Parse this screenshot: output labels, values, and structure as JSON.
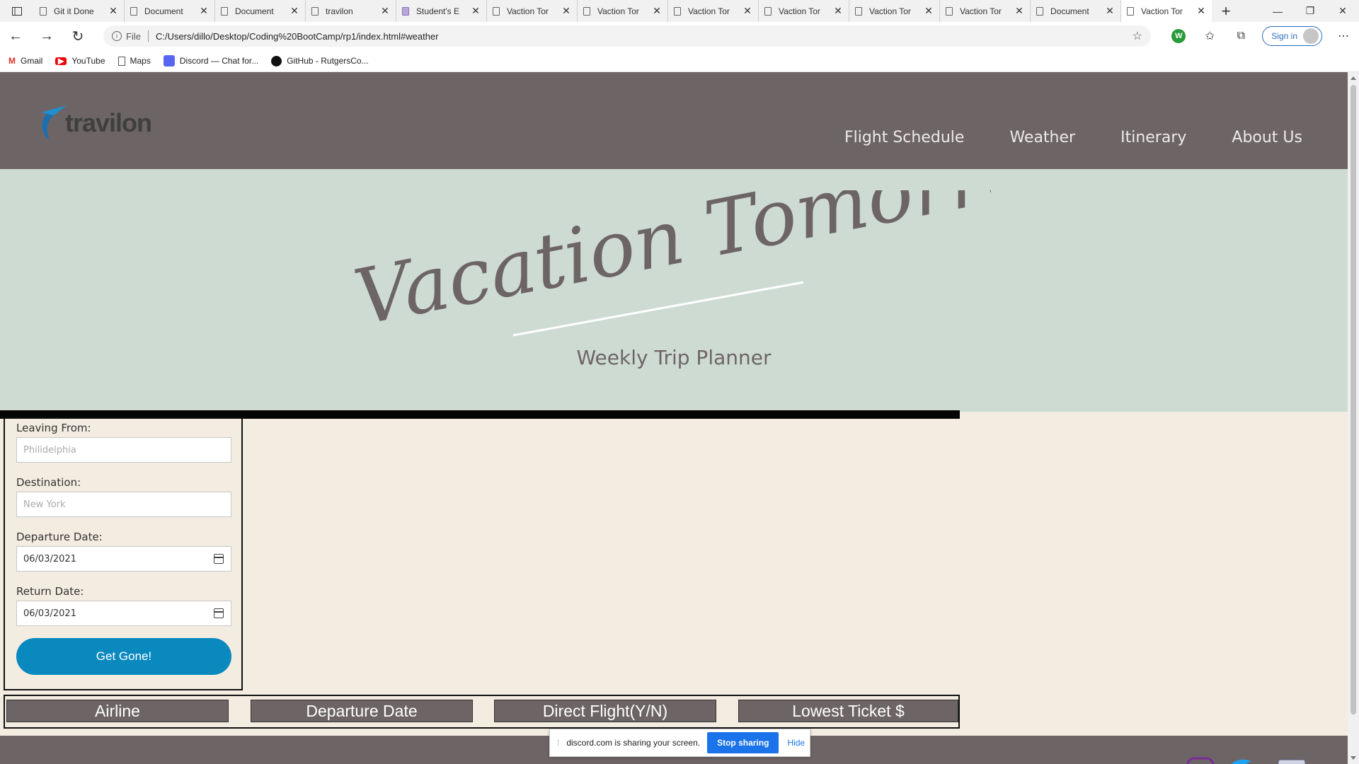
{
  "browser": {
    "tabs": [
      {
        "label": "Git it Done"
      },
      {
        "label": "Document"
      },
      {
        "label": "Document"
      },
      {
        "label": "travilon"
      },
      {
        "label": "Student's E"
      },
      {
        "label": "Vaction Tor"
      },
      {
        "label": "Vaction Tor"
      },
      {
        "label": "Vaction Tor"
      },
      {
        "label": "Vaction Tor"
      },
      {
        "label": "Vaction Tor"
      },
      {
        "label": "Vaction Tor"
      },
      {
        "label": "Document"
      },
      {
        "label": "Vaction Tor"
      }
    ],
    "active_tab_index": 12,
    "new_tab_label": "+",
    "url_prefix": "File",
    "url": "C:/Users/dillo/Desktop/Coding%20BootCamp/rp1/index.html#weather",
    "extension_letter": "W",
    "signin_label": "Sign in",
    "bookmarks": [
      {
        "label": "Gmail",
        "icon": "gmail-icon"
      },
      {
        "label": "YouTube",
        "icon": "youtube-icon"
      },
      {
        "label": "Maps",
        "icon": "page-icon"
      },
      {
        "label": "Discord — Chat for...",
        "icon": "discord-icon"
      },
      {
        "label": "GitHub - RutgersCo...",
        "icon": "github-icon"
      }
    ]
  },
  "site": {
    "logo_text": "travilon",
    "nav": [
      "Flight Schedule",
      "Weather",
      "Itinerary",
      "About Us"
    ],
    "hero_title": "Vacation Tomorrow",
    "hero_subtitle": "Weekly Trip Planner",
    "form": {
      "leaving_label": "Leaving From:",
      "leaving_placeholder": "Philidelphia",
      "destination_label": "Destination:",
      "destination_placeholder": "New York",
      "departure_label": "Departure Date:",
      "departure_value": "06/03/2021",
      "return_label": "Return Date:",
      "return_value": "06/03/2021",
      "submit_label": "Get Gone!"
    },
    "flight_headers": [
      "Airline",
      "Departure Date",
      "Direct Flight(Y/N)",
      "Lowest Ticket $"
    ]
  },
  "share_notice": {
    "text": "discord.com is sharing your screen.",
    "stop_label": "Stop sharing",
    "hide_label": "Hide"
  },
  "colors": {
    "header_bg": "#6d6565",
    "hero_bg": "#cedbd2",
    "page_bg": "#f3ece0",
    "button_blue": "#0a89bf",
    "logo_blue": "#1f8fd0"
  }
}
